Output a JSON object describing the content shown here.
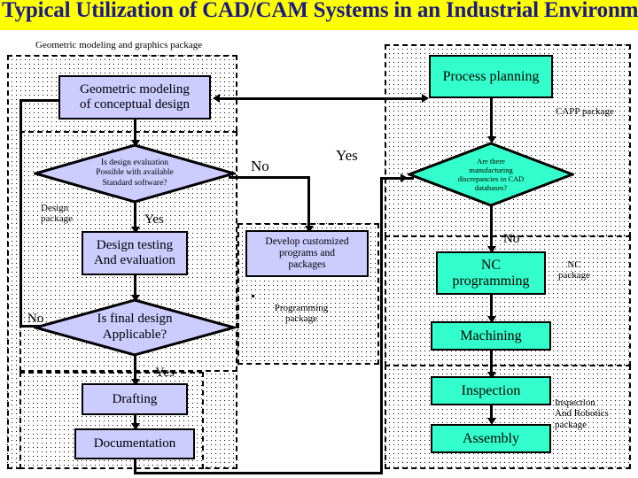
{
  "title": "Typical Utilization of CAD/CAM Systems in an Industrial Environment",
  "colors": {
    "banner": "#FFFF00",
    "title_text": "#1A1A8C",
    "design_fill": "#CCCCFF",
    "manufacturing_fill": "#33FFCC",
    "outline": "#000000"
  },
  "packages": {
    "geometric": "Geometric modeling and graphics package",
    "design": "Design\npackage",
    "programming": "Programming\npackage",
    "capp": "CAPP package",
    "nc": "NC\npackage",
    "inspection": "Inspection\nAnd Robotics\npackage"
  },
  "nodes": {
    "geometric_modeling": "Geometric modeling\nof conceptual design",
    "design_eval_decision": "Is design evaluation\nPossible with  available\nStandard software?",
    "design_testing": "Design testing\nAnd evaluation",
    "final_design_decision": "Is final design\nApplicable?",
    "drafting": "Drafting",
    "documentation": "Documentation",
    "develop_customized": "Develop customized\nprograms and\npackages",
    "process_planning": "Process planning",
    "discrepancies_decision": "Are there\nmanufacturing\ndiscrepancies in CAD\ndatabases?",
    "nc_programming": "NC\nprogramming",
    "machining": "Machining",
    "inspection": "Inspection",
    "assembly": "Assembly"
  },
  "edge_labels": {
    "design_eval_no": "No",
    "design_eval_yes": "Yes",
    "final_design_no": "No",
    "final_design_yes": "Yes",
    "documentation_yes": "Yes",
    "discrepancies_no": "No"
  }
}
